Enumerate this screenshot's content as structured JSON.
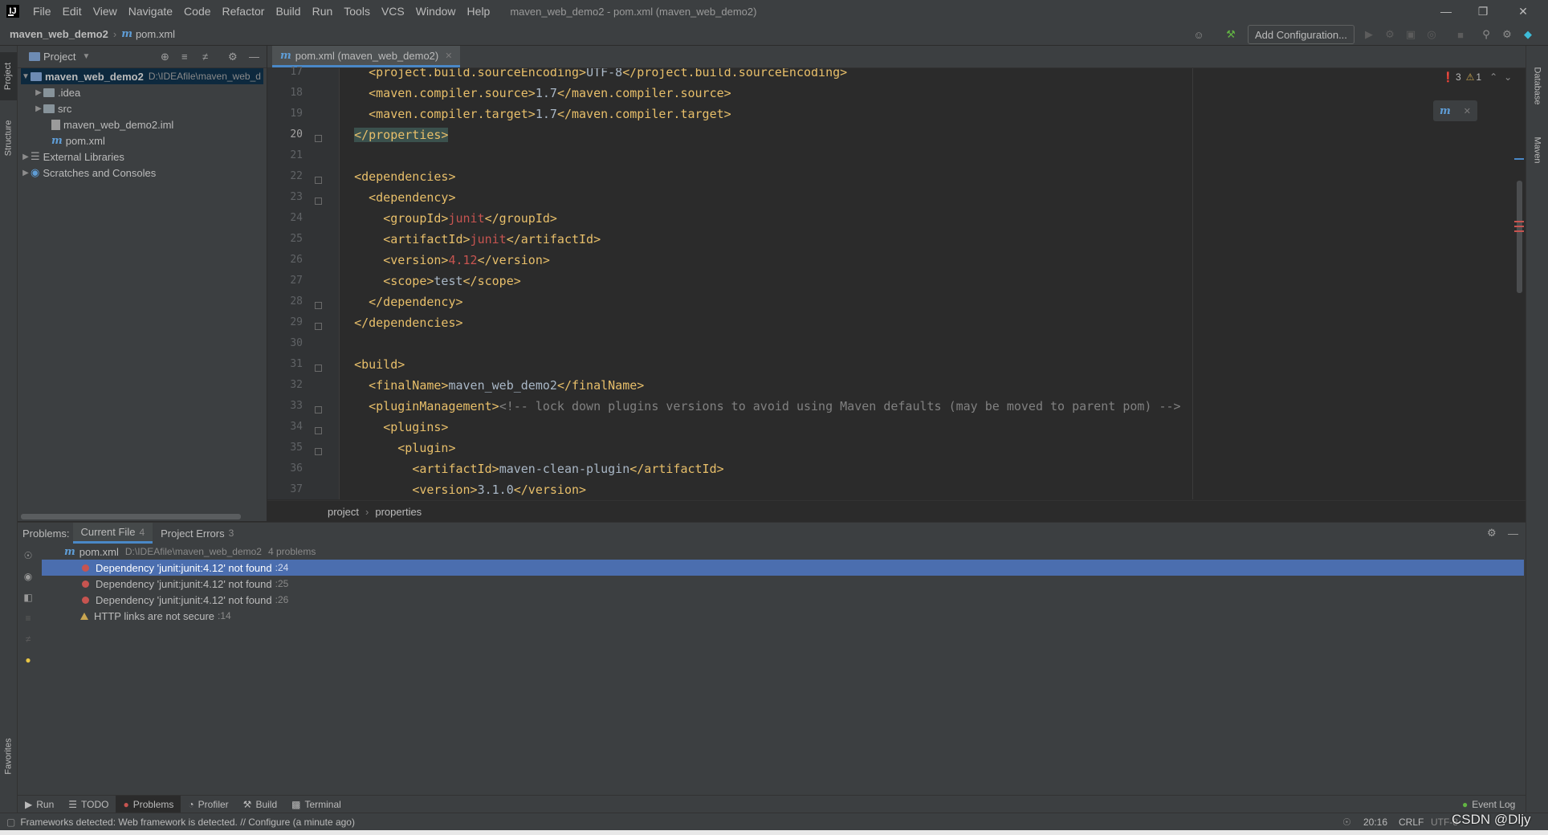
{
  "menu": [
    "File",
    "Edit",
    "View",
    "Navigate",
    "Code",
    "Refactor",
    "Build",
    "Run",
    "Tools",
    "VCS",
    "Window",
    "Help"
  ],
  "window_title": "maven_web_demo2 - pom.xml (maven_web_demo2)",
  "nav": {
    "project": "maven_web_demo2",
    "file": "pom.xml"
  },
  "toolbar": {
    "add_configuration": "Add Configuration..."
  },
  "left_tabs": {
    "project": "Project",
    "structure": "Structure",
    "favorites": "Favorites"
  },
  "right_tabs": {
    "database": "Database",
    "maven": "Maven"
  },
  "project_panel": {
    "title": "Project",
    "tree": [
      {
        "label": "maven_web_demo2",
        "path": "D:\\IDEAfile\\maven_web_d"
      },
      {
        "label": ".idea"
      },
      {
        "label": "src"
      },
      {
        "label": "maven_web_demo2.iml"
      },
      {
        "label": "pom.xml"
      },
      {
        "label": "External Libraries"
      },
      {
        "label": "Scratches and Consoles"
      }
    ]
  },
  "editor": {
    "tab": "pom.xml (maven_web_demo2)",
    "error_count": "3",
    "warning_count": "1",
    "line_numbers": [
      "17",
      "18",
      "19",
      "20",
      "21",
      "22",
      "23",
      "24",
      "25",
      "26",
      "27",
      "28",
      "29",
      "30",
      "31",
      "32",
      "33",
      "34",
      "35",
      "36",
      "37"
    ],
    "lines": [
      {
        "indent": "    ",
        "open": "<project.build.sourceEncoding>",
        "text": "UTF-8",
        "close": "</project.build.sourceEncoding>"
      },
      {
        "indent": "    ",
        "open": "<maven.compiler.source>",
        "text": "1.7",
        "close": "</maven.compiler.source>"
      },
      {
        "indent": "    ",
        "open": "<maven.compiler.target>",
        "text": "1.7",
        "close": "</maven.compiler.target>"
      },
      {
        "indent": "  ",
        "open": "</properties>",
        "text": "",
        "close": ""
      },
      {
        "indent": "",
        "open": "",
        "text": "",
        "close": ""
      },
      {
        "indent": "  ",
        "open": "<dependencies>",
        "text": "",
        "close": ""
      },
      {
        "indent": "    ",
        "open": "<dependency>",
        "text": "",
        "close": ""
      },
      {
        "indent": "      ",
        "open": "<groupId>",
        "text": "junit",
        "close": "</groupId>",
        "error": true
      },
      {
        "indent": "      ",
        "open": "<artifactId>",
        "text": "junit",
        "close": "</artifactId>",
        "error": true
      },
      {
        "indent": "      ",
        "open": "<version>",
        "text": "4.12",
        "close": "</version>",
        "error": true
      },
      {
        "indent": "      ",
        "open": "<scope>",
        "text": "test",
        "close": "</scope>"
      },
      {
        "indent": "    ",
        "open": "</dependency>",
        "text": "",
        "close": ""
      },
      {
        "indent": "  ",
        "open": "</dependencies>",
        "text": "",
        "close": ""
      },
      {
        "indent": "",
        "open": "",
        "text": "",
        "close": ""
      },
      {
        "indent": "  ",
        "open": "<build>",
        "text": "",
        "close": ""
      },
      {
        "indent": "    ",
        "open": "<finalName>",
        "text": "maven_web_demo2",
        "close": "</finalName>"
      },
      {
        "indent": "    ",
        "open": "<pluginManagement>",
        "text": "",
        "close": "",
        "comment": "<!-- lock down plugins versions to avoid using Maven defaults (may be moved to parent pom) -->"
      },
      {
        "indent": "      ",
        "open": "<plugins>",
        "text": "",
        "close": ""
      },
      {
        "indent": "        ",
        "open": "<plugin>",
        "text": "",
        "close": ""
      },
      {
        "indent": "          ",
        "open": "<artifactId>",
        "text": "maven-clean-plugin",
        "close": "</artifactId>"
      },
      {
        "indent": "          ",
        "open": "<version>",
        "text": "3.1.0",
        "close": "</version>"
      }
    ],
    "breadcrumb": [
      "project",
      "properties"
    ]
  },
  "problems": {
    "label": "Problems:",
    "tabs": [
      {
        "label": "Current File",
        "count": "4"
      },
      {
        "label": "Project Errors",
        "count": "3"
      }
    ],
    "file": {
      "name": "pom.xml",
      "path": "D:\\IDEAfile\\maven_web_demo2",
      "summary": "4 problems"
    },
    "items": [
      {
        "text": "Dependency 'junit:junit:4.12' not found",
        "line": ":24",
        "kind": "error"
      },
      {
        "text": "Dependency 'junit:junit:4.12' not found",
        "line": ":25",
        "kind": "error"
      },
      {
        "text": "Dependency 'junit:junit:4.12' not found",
        "line": ":26",
        "kind": "error"
      },
      {
        "text": "HTTP links are not secure",
        "line": ":14",
        "kind": "warning"
      }
    ]
  },
  "tool_windows": [
    "Run",
    "TODO",
    "Problems",
    "Profiler",
    "Build",
    "Terminal"
  ],
  "event_log": "Event Log",
  "status": {
    "message": "Frameworks detected: Web framework is detected. // Configure (a minute ago)",
    "position": "20:16",
    "line_sep": "CRLF",
    "encoding": "UTF-8",
    "watermark": "CSDN @Dljy"
  }
}
